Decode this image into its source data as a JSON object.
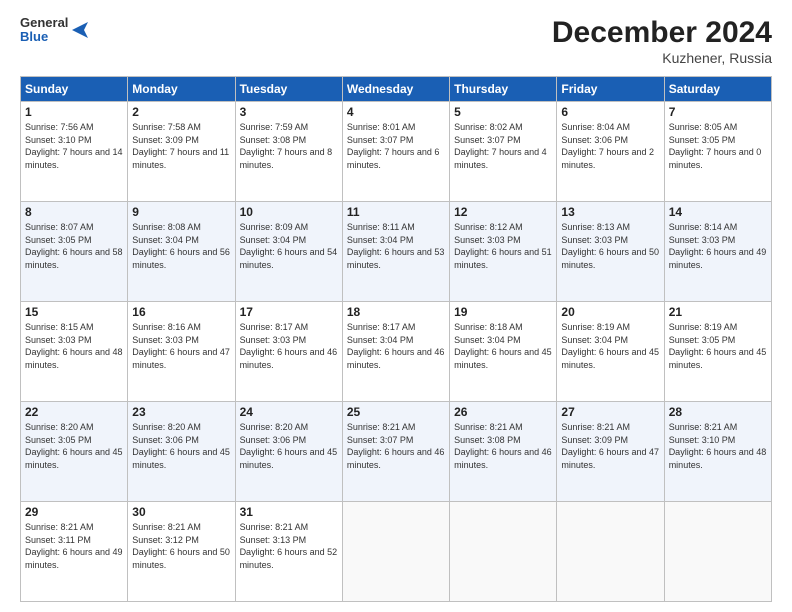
{
  "logo": {
    "line1": "General",
    "line2": "Blue"
  },
  "header": {
    "month": "December 2024",
    "location": "Kuzhener, Russia"
  },
  "days_of_week": [
    "Sunday",
    "Monday",
    "Tuesday",
    "Wednesday",
    "Thursday",
    "Friday",
    "Saturday"
  ],
  "weeks": [
    [
      {
        "day": "1",
        "sunrise": "7:56 AM",
        "sunset": "3:10 PM",
        "daylight": "7 hours and 14 minutes."
      },
      {
        "day": "2",
        "sunrise": "7:58 AM",
        "sunset": "3:09 PM",
        "daylight": "7 hours and 11 minutes."
      },
      {
        "day": "3",
        "sunrise": "7:59 AM",
        "sunset": "3:08 PM",
        "daylight": "7 hours and 8 minutes."
      },
      {
        "day": "4",
        "sunrise": "8:01 AM",
        "sunset": "3:07 PM",
        "daylight": "7 hours and 6 minutes."
      },
      {
        "day": "5",
        "sunrise": "8:02 AM",
        "sunset": "3:07 PM",
        "daylight": "7 hours and 4 minutes."
      },
      {
        "day": "6",
        "sunrise": "8:04 AM",
        "sunset": "3:06 PM",
        "daylight": "7 hours and 2 minutes."
      },
      {
        "day": "7",
        "sunrise": "8:05 AM",
        "sunset": "3:05 PM",
        "daylight": "7 hours and 0 minutes."
      }
    ],
    [
      {
        "day": "8",
        "sunrise": "8:07 AM",
        "sunset": "3:05 PM",
        "daylight": "6 hours and 58 minutes."
      },
      {
        "day": "9",
        "sunrise": "8:08 AM",
        "sunset": "3:04 PM",
        "daylight": "6 hours and 56 minutes."
      },
      {
        "day": "10",
        "sunrise": "8:09 AM",
        "sunset": "3:04 PM",
        "daylight": "6 hours and 54 minutes."
      },
      {
        "day": "11",
        "sunrise": "8:11 AM",
        "sunset": "3:04 PM",
        "daylight": "6 hours and 53 minutes."
      },
      {
        "day": "12",
        "sunrise": "8:12 AM",
        "sunset": "3:03 PM",
        "daylight": "6 hours and 51 minutes."
      },
      {
        "day": "13",
        "sunrise": "8:13 AM",
        "sunset": "3:03 PM",
        "daylight": "6 hours and 50 minutes."
      },
      {
        "day": "14",
        "sunrise": "8:14 AM",
        "sunset": "3:03 PM",
        "daylight": "6 hours and 49 minutes."
      }
    ],
    [
      {
        "day": "15",
        "sunrise": "8:15 AM",
        "sunset": "3:03 PM",
        "daylight": "6 hours and 48 minutes."
      },
      {
        "day": "16",
        "sunrise": "8:16 AM",
        "sunset": "3:03 PM",
        "daylight": "6 hours and 47 minutes."
      },
      {
        "day": "17",
        "sunrise": "8:17 AM",
        "sunset": "3:03 PM",
        "daylight": "6 hours and 46 minutes."
      },
      {
        "day": "18",
        "sunrise": "8:17 AM",
        "sunset": "3:04 PM",
        "daylight": "6 hours and 46 minutes."
      },
      {
        "day": "19",
        "sunrise": "8:18 AM",
        "sunset": "3:04 PM",
        "daylight": "6 hours and 45 minutes."
      },
      {
        "day": "20",
        "sunrise": "8:19 AM",
        "sunset": "3:04 PM",
        "daylight": "6 hours and 45 minutes."
      },
      {
        "day": "21",
        "sunrise": "8:19 AM",
        "sunset": "3:05 PM",
        "daylight": "6 hours and 45 minutes."
      }
    ],
    [
      {
        "day": "22",
        "sunrise": "8:20 AM",
        "sunset": "3:05 PM",
        "daylight": "6 hours and 45 minutes."
      },
      {
        "day": "23",
        "sunrise": "8:20 AM",
        "sunset": "3:06 PM",
        "daylight": "6 hours and 45 minutes."
      },
      {
        "day": "24",
        "sunrise": "8:20 AM",
        "sunset": "3:06 PM",
        "daylight": "6 hours and 45 minutes."
      },
      {
        "day": "25",
        "sunrise": "8:21 AM",
        "sunset": "3:07 PM",
        "daylight": "6 hours and 46 minutes."
      },
      {
        "day": "26",
        "sunrise": "8:21 AM",
        "sunset": "3:08 PM",
        "daylight": "6 hours and 46 minutes."
      },
      {
        "day": "27",
        "sunrise": "8:21 AM",
        "sunset": "3:09 PM",
        "daylight": "6 hours and 47 minutes."
      },
      {
        "day": "28",
        "sunrise": "8:21 AM",
        "sunset": "3:10 PM",
        "daylight": "6 hours and 48 minutes."
      }
    ],
    [
      {
        "day": "29",
        "sunrise": "8:21 AM",
        "sunset": "3:11 PM",
        "daylight": "6 hours and 49 minutes."
      },
      {
        "day": "30",
        "sunrise": "8:21 AM",
        "sunset": "3:12 PM",
        "daylight": "6 hours and 50 minutes."
      },
      {
        "day": "31",
        "sunrise": "8:21 AM",
        "sunset": "3:13 PM",
        "daylight": "6 hours and 52 minutes."
      },
      null,
      null,
      null,
      null
    ]
  ]
}
